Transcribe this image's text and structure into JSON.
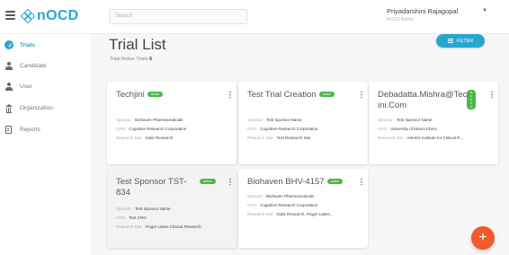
{
  "header": {
    "logo_text": "nOCD",
    "search_placeholder": "Search",
    "user_name": "Priyadarshini Rajagopal",
    "user_role": "NOCD Admin"
  },
  "sidebar": {
    "items": [
      {
        "label": "Trials",
        "icon": "check-circle-icon",
        "active": true
      },
      {
        "label": "Candidate",
        "icon": "candidate-icon",
        "active": false
      },
      {
        "label": "User",
        "icon": "user-icon",
        "active": false
      },
      {
        "label": "Organization",
        "icon": "bank-icon",
        "active": false
      },
      {
        "label": "Reports",
        "icon": "report-icon",
        "active": false
      }
    ]
  },
  "main": {
    "title": "Trial List",
    "subtitle_label": "Total Active Trials",
    "subtitle_count": "6",
    "filter_label": "FILTER",
    "status_label": "Active",
    "meta_labels": {
      "sponsor": "Sponsor:",
      "cro": "CRO:",
      "site": "Research Site:"
    },
    "trials": [
      {
        "title": "Techjini",
        "sponsor": "Biohaven Pharmaceuticals",
        "cro": "Cognitive Research Corporation",
        "site": "Galiz Research"
      },
      {
        "title": "Test Trial Creation",
        "sponsor": "Test Sponsor Name",
        "cro": "Cognitive Research Corporation",
        "site": "Test Research Site"
      },
      {
        "title": "Debadatta.Mishra@Techjini.Com",
        "sponsor": "Test Sponsor Name",
        "cro": "University of Mount Kheru",
        "site": "Artemis Institute for Clinical R..."
      },
      {
        "title": "Test Sponsor TST-834",
        "sponsor": "Test Sponsor Name",
        "cro": "Test CRO",
        "site": "Finger Lakes Clinical Research"
      },
      {
        "title": "Biohaven BHV-4157",
        "sponsor": "Biohaven Pharmaceuticals",
        "cro": "Cognitive Research Corporation",
        "site": "Galiz Research, Finger Lakes..."
      }
    ],
    "fab_label": "+"
  },
  "colors": {
    "accent": "#2aa6ce",
    "active_badge": "#4ab84a",
    "fab": "#f15a2b"
  }
}
